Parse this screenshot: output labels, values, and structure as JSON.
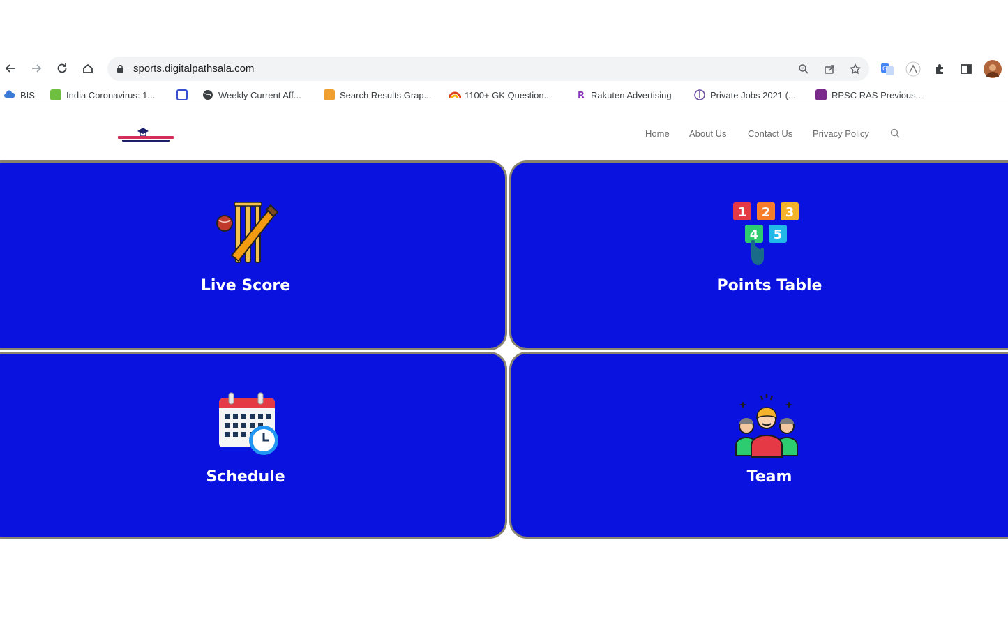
{
  "browser": {
    "url": "sports.digitalpathsala.com",
    "bookmarks": [
      {
        "label": "BIS",
        "color": "#3b7bd8"
      },
      {
        "label": "India Coronavirus: 1...",
        "color": "#6fc041"
      },
      {
        "label": "",
        "color": "#3a4fd0"
      },
      {
        "label": "Weekly Current Aff...",
        "color": "#3c4043"
      },
      {
        "label": "Search Results Grap...",
        "color": "#f0a030"
      },
      {
        "label": "1100+ GK Question...",
        "color": "#e04020"
      },
      {
        "label": "Rakuten Advertising",
        "color": "#8a3ab9"
      },
      {
        "label": "Private Jobs 2021 (...",
        "color": "#6b4fa0"
      },
      {
        "label": "RPSC RAS Previous...",
        "color": "#7a2a8a"
      }
    ]
  },
  "site": {
    "nav": [
      "Home",
      "About Us",
      "Contact Us",
      "Privacy Policy"
    ]
  },
  "tiles": [
    {
      "label": "Live Score",
      "icon": "cricket-icon"
    },
    {
      "label": "Points Table",
      "icon": "points-table-icon"
    },
    {
      "label": "Schedule",
      "icon": "calendar-clock-icon"
    },
    {
      "label": "Team",
      "icon": "team-icon"
    }
  ],
  "points_icon_numbers": [
    "1",
    "2",
    "3",
    "4",
    "5"
  ],
  "colors": {
    "tile_bg": "#0a12e0",
    "tile_text": "#ffffff"
  }
}
